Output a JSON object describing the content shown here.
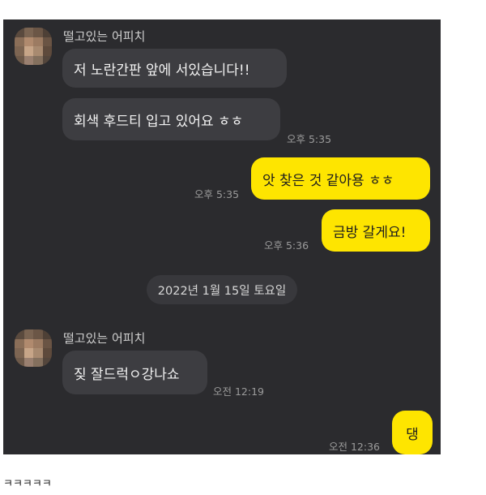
{
  "chat": {
    "background": "#2b2b2e",
    "incoming_bubble_color": "#3d3d41",
    "outgoing_bubble_color": "#fee500",
    "group1": {
      "sender_name": "떨고있는 어피치",
      "avatar_icon": "pixelated-avatar-icon",
      "messages": [
        "저 노란간판 앞에 서있습니다!!",
        "회색 후드티 입고 있어요 ㅎㅎ"
      ],
      "time": "오후 5:35"
    },
    "outgoing1": {
      "message": "앗 찾은 것 같아용 ㅎㅎ",
      "time": "오후 5:35"
    },
    "outgoing2": {
      "message": "금방 갈게요!",
      "time": "오후 5:36"
    },
    "date_divider": "2022년 1월 15일 토요일",
    "group2": {
      "sender_name": "떨고있는 어피치",
      "avatar_icon": "pixelated-avatar-icon",
      "message": "짖 잘드럭ㅇ강나쇼",
      "time": "오전 12:19"
    },
    "outgoing3": {
      "message": "댕",
      "time": "오전 12:36"
    }
  },
  "caption": "ㅋㅋㅋㅋㅋ"
}
